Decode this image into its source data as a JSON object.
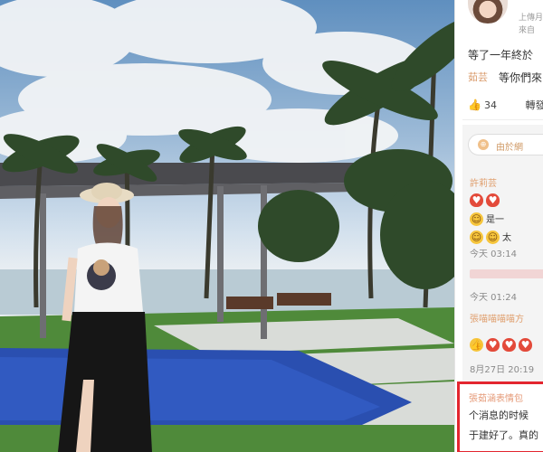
{
  "post": {
    "source_line1": "上傳月",
    "source_line2": "來自",
    "text": "等了一年終於",
    "mention": "茹芸",
    "text2": "等你們來",
    "likes": "34",
    "forward_label": "轉發"
  },
  "comments": {
    "pill_label": "由於網",
    "pill_icon": "⊕",
    "c1": {
      "user": "許莉芸 ",
      "text": "是一",
      "text2": "太",
      "time": "今天 03:14"
    },
    "c2": {
      "time": "今天 01:24"
    },
    "c3": {
      "user": "張喵喵喵喵方",
      "time": "8月27日 20:19"
    }
  },
  "highlight": {
    "user": "張茹涵表情包",
    "line1": "个消息的时候",
    "line2": "于建好了。真的"
  },
  "colors": {
    "accent": "#e3262f",
    "mention": "#d99a6a",
    "heart": "#e34a3a"
  }
}
